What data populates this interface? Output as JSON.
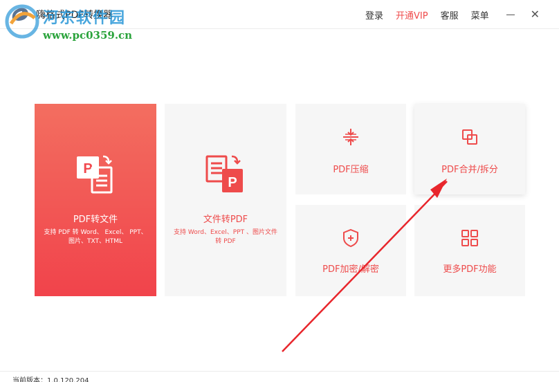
{
  "header": {
    "app_title": "嗨格式PDF转换器",
    "nav": {
      "login": "登录",
      "vip": "开通VIP",
      "service": "客服",
      "menu": "菜单"
    },
    "minimize_icon": "minimize-icon",
    "close_glyph": "✕"
  },
  "watermark": {
    "line1": "河东软件园",
    "line2": "www.pc0359.cn"
  },
  "tiles": {
    "pdf_to_file": {
      "title": "PDF转文件",
      "desc": "支持 PDF 转 Word、 Excel、 PPT、图片、TXT、HTML",
      "icon": "pdf-to-file-icon"
    },
    "file_to_pdf": {
      "title": "文件转PDF",
      "desc": "支持 Word、Excel、PPT 、图片文件转 PDF",
      "icon": "file-to-pdf-icon"
    },
    "compress": {
      "title": "PDF压缩",
      "icon": "compress-icon"
    },
    "merge_split": {
      "title": "PDF合并/拆分",
      "icon": "merge-icon"
    },
    "encrypt": {
      "title": "PDF加密/解密",
      "icon": "shield-icon"
    },
    "more": {
      "title": "更多PDF功能",
      "icon": "grid-icon"
    }
  },
  "footer": {
    "version": "当前版本：1.0.120.204"
  },
  "colors": {
    "accent": "#ef4a4a",
    "tile_bg": "#f6f6f6"
  }
}
